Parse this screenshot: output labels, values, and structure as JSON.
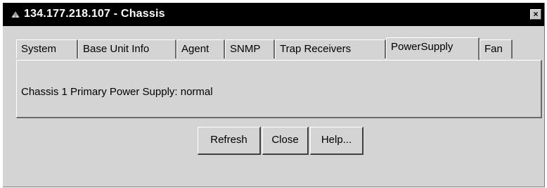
{
  "window": {
    "title": "134.177.218.107 - Chassis",
    "close_label": "×"
  },
  "tabs": [
    {
      "label": "System"
    },
    {
      "label": "Base Unit Info"
    },
    {
      "label": "Agent"
    },
    {
      "label": "SNMP"
    },
    {
      "label": "Trap Receivers"
    },
    {
      "label": "PowerSupply",
      "selected": true
    },
    {
      "label": "Fan"
    }
  ],
  "panel": {
    "status_text": "Chassis 1 Primary Power Supply: normal"
  },
  "buttons": {
    "refresh": "Refresh",
    "close": "Close",
    "help": "Help..."
  },
  "colors": {
    "titlebar_bg": "#000000",
    "window_bg": "#d4d4d4",
    "title_text": "#ffffff"
  }
}
